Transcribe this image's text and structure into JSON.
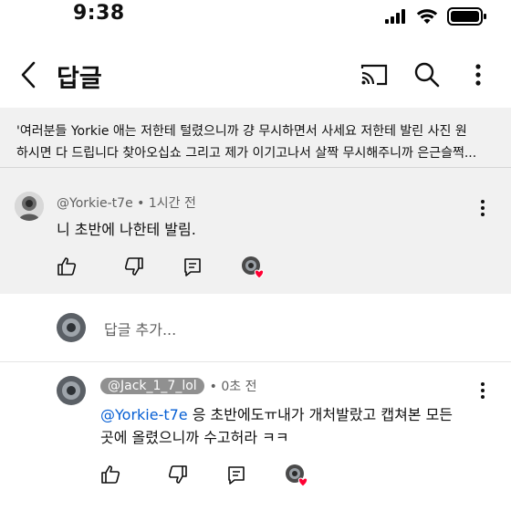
{
  "status_bar": {
    "time": "9:38"
  },
  "header": {
    "title": "답글"
  },
  "parent_post": {
    "line1": "'여러분들 Yorkie  애는 저한테 털렸으니까 걍 무시하면서 사세요 저한테 발린 사진 원",
    "line2": "하시면 다 드립니다 찾아오십쇼 그리고 제가 이기고나서 살짝 무시해주니까 은근슬쩍..."
  },
  "comment1": {
    "author": "@Yorkie-t7e",
    "time": "• 1시간 전",
    "text": "니 초반에 나한테 발림."
  },
  "add_reply": {
    "placeholder": "답글 추가..."
  },
  "reply1": {
    "author": "@Jack_1_7_lol",
    "time": "• 0초 전",
    "mention": "@Yorkie-t7e",
    "text_line1": " 응 초반에도ㅠ내가 개처발랐고 캡쳐본 모든",
    "text_line2": "곳에 올렸으니까 수고허라 ㅋㅋ"
  },
  "colors": {
    "link": "#065fd4",
    "heart": "#ff0033",
    "gray_bg": "#f1f1f1"
  }
}
